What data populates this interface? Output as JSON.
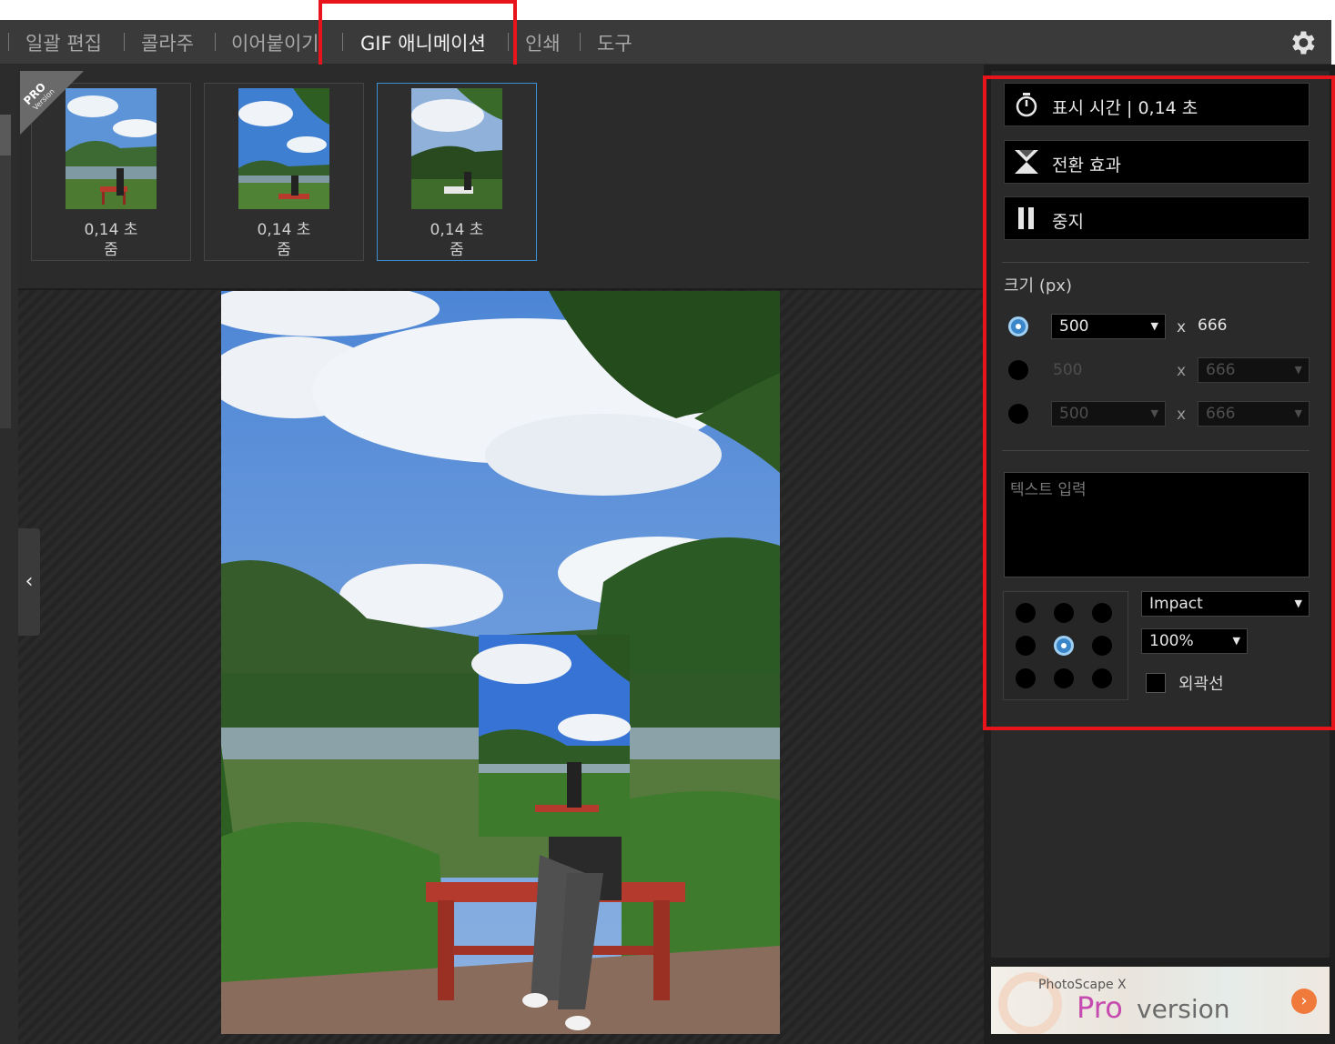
{
  "menu": {
    "items": [
      "일괄 편집",
      "콜라주",
      "이어붙이기",
      "GIF 애니메이션",
      "인쇄",
      "도구"
    ],
    "active_index": 3
  },
  "badge": {
    "line1": "PRO",
    "line2": "Version"
  },
  "thumbnails": [
    {
      "duration": "0,14 초",
      "effect": "줌"
    },
    {
      "duration": "0,14 초",
      "effect": "줌"
    },
    {
      "duration": "0,14 초",
      "effect": "줌",
      "selected": true
    }
  ],
  "panel": {
    "display_time_label": "표시 시간 | 0,14 초",
    "transition_label": "전환 효과",
    "stop_label": "중지",
    "size_label": "크기 (px)",
    "size_rows": [
      {
        "selected": true,
        "width": "500",
        "x": "x",
        "height": "666",
        "enabled": true
      },
      {
        "selected": false,
        "width": "500",
        "x": "x",
        "height": "666",
        "enabled": false
      },
      {
        "selected": false,
        "width": "500",
        "x": "x",
        "height": "666",
        "enabled": false
      }
    ],
    "text_placeholder": "텍스트 입력",
    "font": "Impact",
    "font_size": "100%",
    "outline_label": "외곽선",
    "position_selected": 4
  },
  "ad": {
    "small": "PhotoScape X",
    "pro": "Pro",
    "version": "version"
  },
  "colors": {
    "accent": "#3a86c8",
    "highlight": "#e8141c",
    "selected_border": "#3d8fd4"
  },
  "icons": [
    "settings-gear-icon",
    "timer-icon",
    "transition-icon",
    "pause-icon",
    "chevron-left-icon",
    "arrow-right-icon"
  ]
}
